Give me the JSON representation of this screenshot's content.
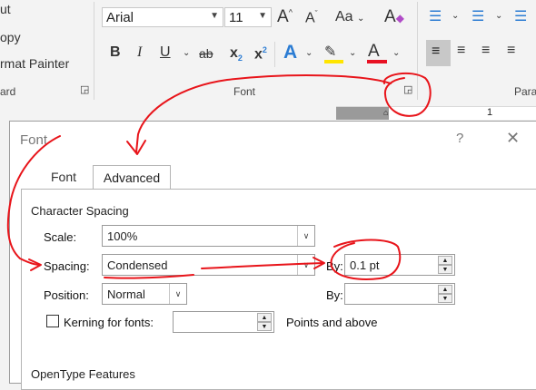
{
  "ribbon": {
    "clipboard": {
      "line1": "ut",
      "line2": "opy",
      "line3": "rmat Painter",
      "group_label": "ard"
    },
    "font_group": {
      "font_name": "Arial",
      "font_size": "11",
      "group_label": "Font",
      "grow_label": "A",
      "shrink_label": "A",
      "case_label": "Aa",
      "bold": "B",
      "italic": "I",
      "underline": "U",
      "strike": "ab",
      "subscript": "x",
      "superscript": "x"
    },
    "paragraph_group": {
      "group_label": "Para"
    },
    "ruler_label": "1"
  },
  "dialog": {
    "title": "Font",
    "help": "?",
    "close": "✕",
    "tabs": [
      {
        "label": "Font"
      },
      {
        "label": "Advanced"
      }
    ],
    "character_spacing": {
      "heading": "Character Spacing",
      "scale_label": "Scale:",
      "scale_value": "100%",
      "spacing_label": "Spacing:",
      "spacing_value": "Condensed",
      "by_label": "By:",
      "spacing_by_value": "0.1 pt",
      "position_label": "Position:",
      "position_value": "Normal",
      "position_by_label": "By:",
      "position_by_value": "",
      "kerning_label": "Kerning for fonts:",
      "kerning_value": "",
      "points_label": "Points and above"
    },
    "opentype_heading": "OpenType Features"
  },
  "colors": {
    "annotation_red": "#e8141a",
    "highlight_yellow": "#ffe500",
    "font_color_red": "#e81123",
    "text_effects_blue": "#2b7cd3"
  }
}
